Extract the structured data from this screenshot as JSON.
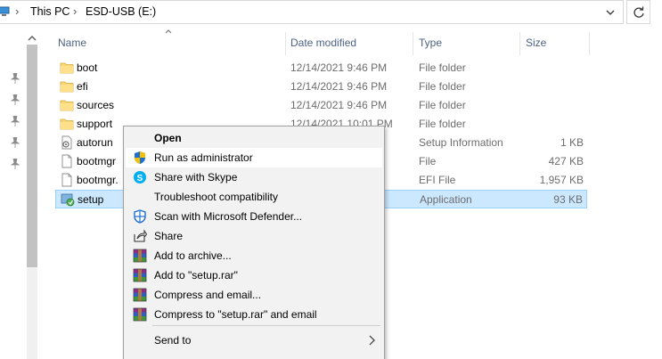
{
  "address_bar": {
    "crumbs": [
      "This PC",
      "ESD-USB (E:)"
    ]
  },
  "columns": {
    "name": "Name",
    "date": "Date modified",
    "type": "Type",
    "size": "Size"
  },
  "files": [
    {
      "name": "boot",
      "date": "12/14/2021 9:46 PM",
      "type": "File folder",
      "size": "",
      "icon": "folder-icon"
    },
    {
      "name": "efi",
      "date": "12/14/2021 9:46 PM",
      "type": "File folder",
      "size": "",
      "icon": "folder-icon"
    },
    {
      "name": "sources",
      "date": "12/14/2021 9:46 PM",
      "type": "File folder",
      "size": "",
      "icon": "folder-icon"
    },
    {
      "name": "support",
      "date": "12/14/2021 10:01 PM",
      "type": "File folder",
      "size": "",
      "icon": "folder-icon"
    },
    {
      "name": "autorun",
      "date": "",
      "type": "Setup Information",
      "size": "1 KB",
      "icon": "setup-info-file-icon"
    },
    {
      "name": "bootmgr",
      "date": "",
      "type": "File",
      "size": "427 KB",
      "icon": "file-icon"
    },
    {
      "name": "bootmgr.",
      "date": "",
      "type": "EFI File",
      "size": "1,957 KB",
      "icon": "file-icon"
    },
    {
      "name": "setup",
      "date": "",
      "type": "Application",
      "size": "93 KB",
      "icon": "setup-app-icon",
      "selected": true
    }
  ],
  "context_menu": {
    "items": [
      {
        "label": "Open",
        "bold": true,
        "icon": ""
      },
      {
        "label": "Run as administrator",
        "icon": "uac-shield-icon",
        "hover": true
      },
      {
        "label": "Share with Skype",
        "icon": "skype-icon"
      },
      {
        "label": "Troubleshoot compatibility",
        "icon": ""
      },
      {
        "label": "Scan with Microsoft Defender...",
        "icon": "defender-icon"
      },
      {
        "label": "Share",
        "icon": "share-icon"
      },
      {
        "label": "Add to archive...",
        "icon": "winrar-icon"
      },
      {
        "label": "Add to \"setup.rar\"",
        "icon": "winrar-icon"
      },
      {
        "label": "Compress and email...",
        "icon": "winrar-icon"
      },
      {
        "label": "Compress to \"setup.rar\" and email",
        "icon": "winrar-icon"
      },
      {
        "label": "Send to",
        "icon": "",
        "submenu": true
      }
    ]
  },
  "colors": {
    "selection_bg": "#cce8ff",
    "selection_border": "#99d1ff",
    "header_text": "#4d6185",
    "menu_bg": "#f2f2f2"
  }
}
